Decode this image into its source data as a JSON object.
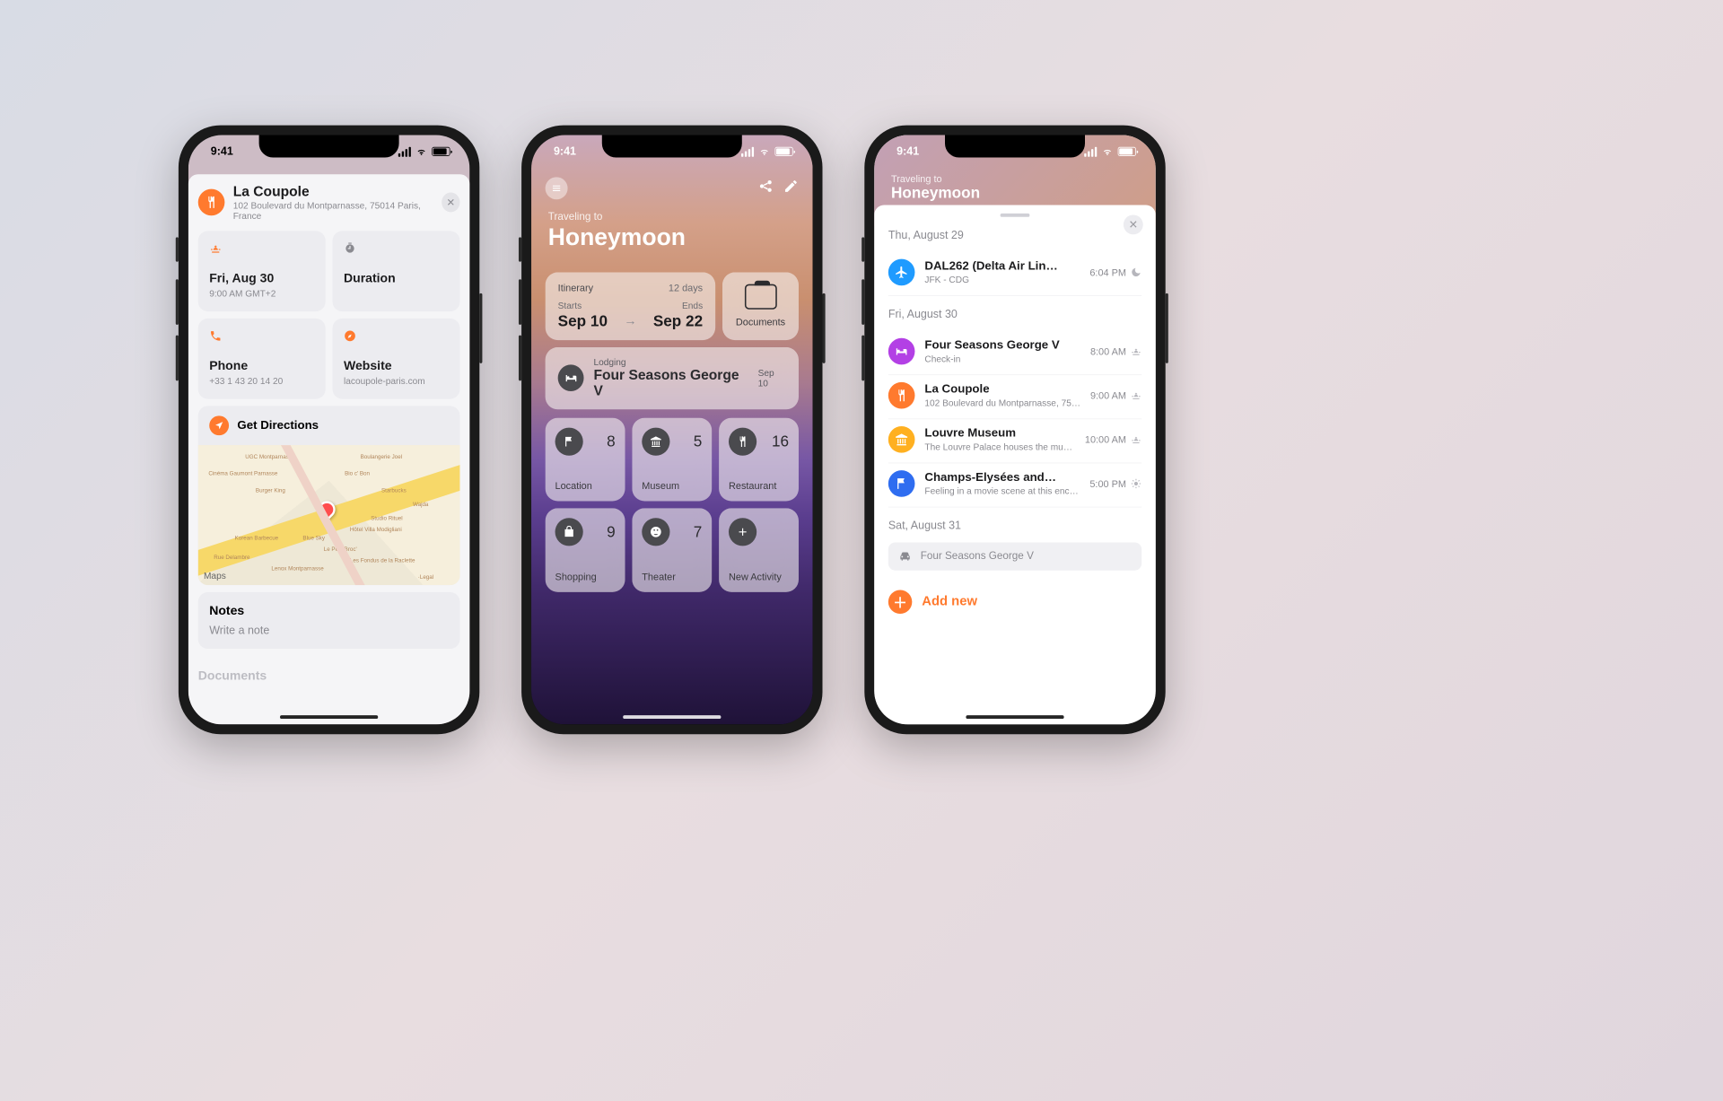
{
  "status": {
    "time": "9:41"
  },
  "phone1": {
    "place": {
      "name": "La Coupole",
      "address": "102 Boulevard du Montparnasse, 75014 Paris, France"
    },
    "cards": {
      "date": {
        "title": "Fri, Aug 30",
        "sub": "9:00 AM GMT+2"
      },
      "duration": {
        "title": "Duration"
      },
      "phone": {
        "title": "Phone",
        "sub": "+33 1 43 20 14 20"
      },
      "website": {
        "title": "Website",
        "sub": "lacoupole-paris.com"
      }
    },
    "directions_label": "Get Directions",
    "map_attribution": "Maps",
    "notes": {
      "heading": "Notes",
      "placeholder": "Write a note"
    },
    "documents_label": "Documents",
    "map_pois": [
      "UGC Montparnasse",
      "Boulangerie Joel",
      "Cinéma Gaumont Parnasse",
      "Bio c' Bon",
      "Burger King",
      "Starbucks",
      "Wajda",
      "Studio Rituel",
      "Korean Barbecue",
      "Blue Sky",
      "Hôtel Villa Modigliani",
      "Rue Delambre",
      "Le Petit Broc'",
      "Lenox Montparnasse",
      "Les Fondus de la Raclette",
      "·Legal"
    ]
  },
  "phone2": {
    "subtitle": "Traveling to",
    "title": "Honeymoon",
    "itinerary": {
      "label": "Itinerary",
      "days": "12 days",
      "starts_label": "Starts",
      "ends_label": "Ends",
      "start": "Sep 10",
      "end": "Sep 22"
    },
    "documents_label": "Documents",
    "lodging": {
      "label": "Lodging",
      "name": "Four Seasons George V",
      "date": "Sep 10"
    },
    "tiles": [
      {
        "name": "location",
        "label": "Location",
        "count": "8"
      },
      {
        "name": "museum",
        "label": "Museum",
        "count": "5"
      },
      {
        "name": "restaurant",
        "label": "Restaurant",
        "count": "16"
      },
      {
        "name": "shopping",
        "label": "Shopping",
        "count": "9"
      },
      {
        "name": "theater",
        "label": "Theater",
        "count": "7"
      },
      {
        "name": "add",
        "label": "New Activity",
        "count": ""
      }
    ]
  },
  "phone3": {
    "subtitle": "Traveling to",
    "title": "Honeymoon",
    "days": {
      "d1": {
        "label": "Thu, August 29",
        "events": [
          {
            "color": "c-blue",
            "icon": "plane",
            "title": "DAL262 (Delta Air Lin…",
            "sub": "JFK - CDG",
            "time": "6:04 PM",
            "tod": "moon"
          }
        ]
      },
      "d2": {
        "label": "Fri, August 30",
        "events": [
          {
            "color": "c-purple",
            "icon": "bed",
            "title": "Four Seasons George V",
            "sub": "Check-in",
            "time": "8:00 AM",
            "tod": "sun"
          },
          {
            "color": "c-orange",
            "icon": "fork",
            "title": "La Coupole",
            "sub": "102 Boulevard du Montparnasse, 75014 Paris, Fran…",
            "time": "9:00 AM",
            "tod": "sun"
          },
          {
            "color": "c-yellow",
            "icon": "museum",
            "title": "Louvre Museum",
            "sub": "The Louvre Palace houses the museum with the s…",
            "time": "10:00 AM",
            "tod": "sun"
          },
          {
            "color": "c-flagblue",
            "icon": "flag",
            "title": "Champs-Elysées and…",
            "sub": "Feeling in a movie scene at this enchanting aven…",
            "time": "5:00 PM",
            "tod": "sunbright"
          }
        ]
      },
      "d3": {
        "label": "Sat, August 31",
        "stay": "Four Seasons George V"
      }
    },
    "add_label": "Add new"
  }
}
